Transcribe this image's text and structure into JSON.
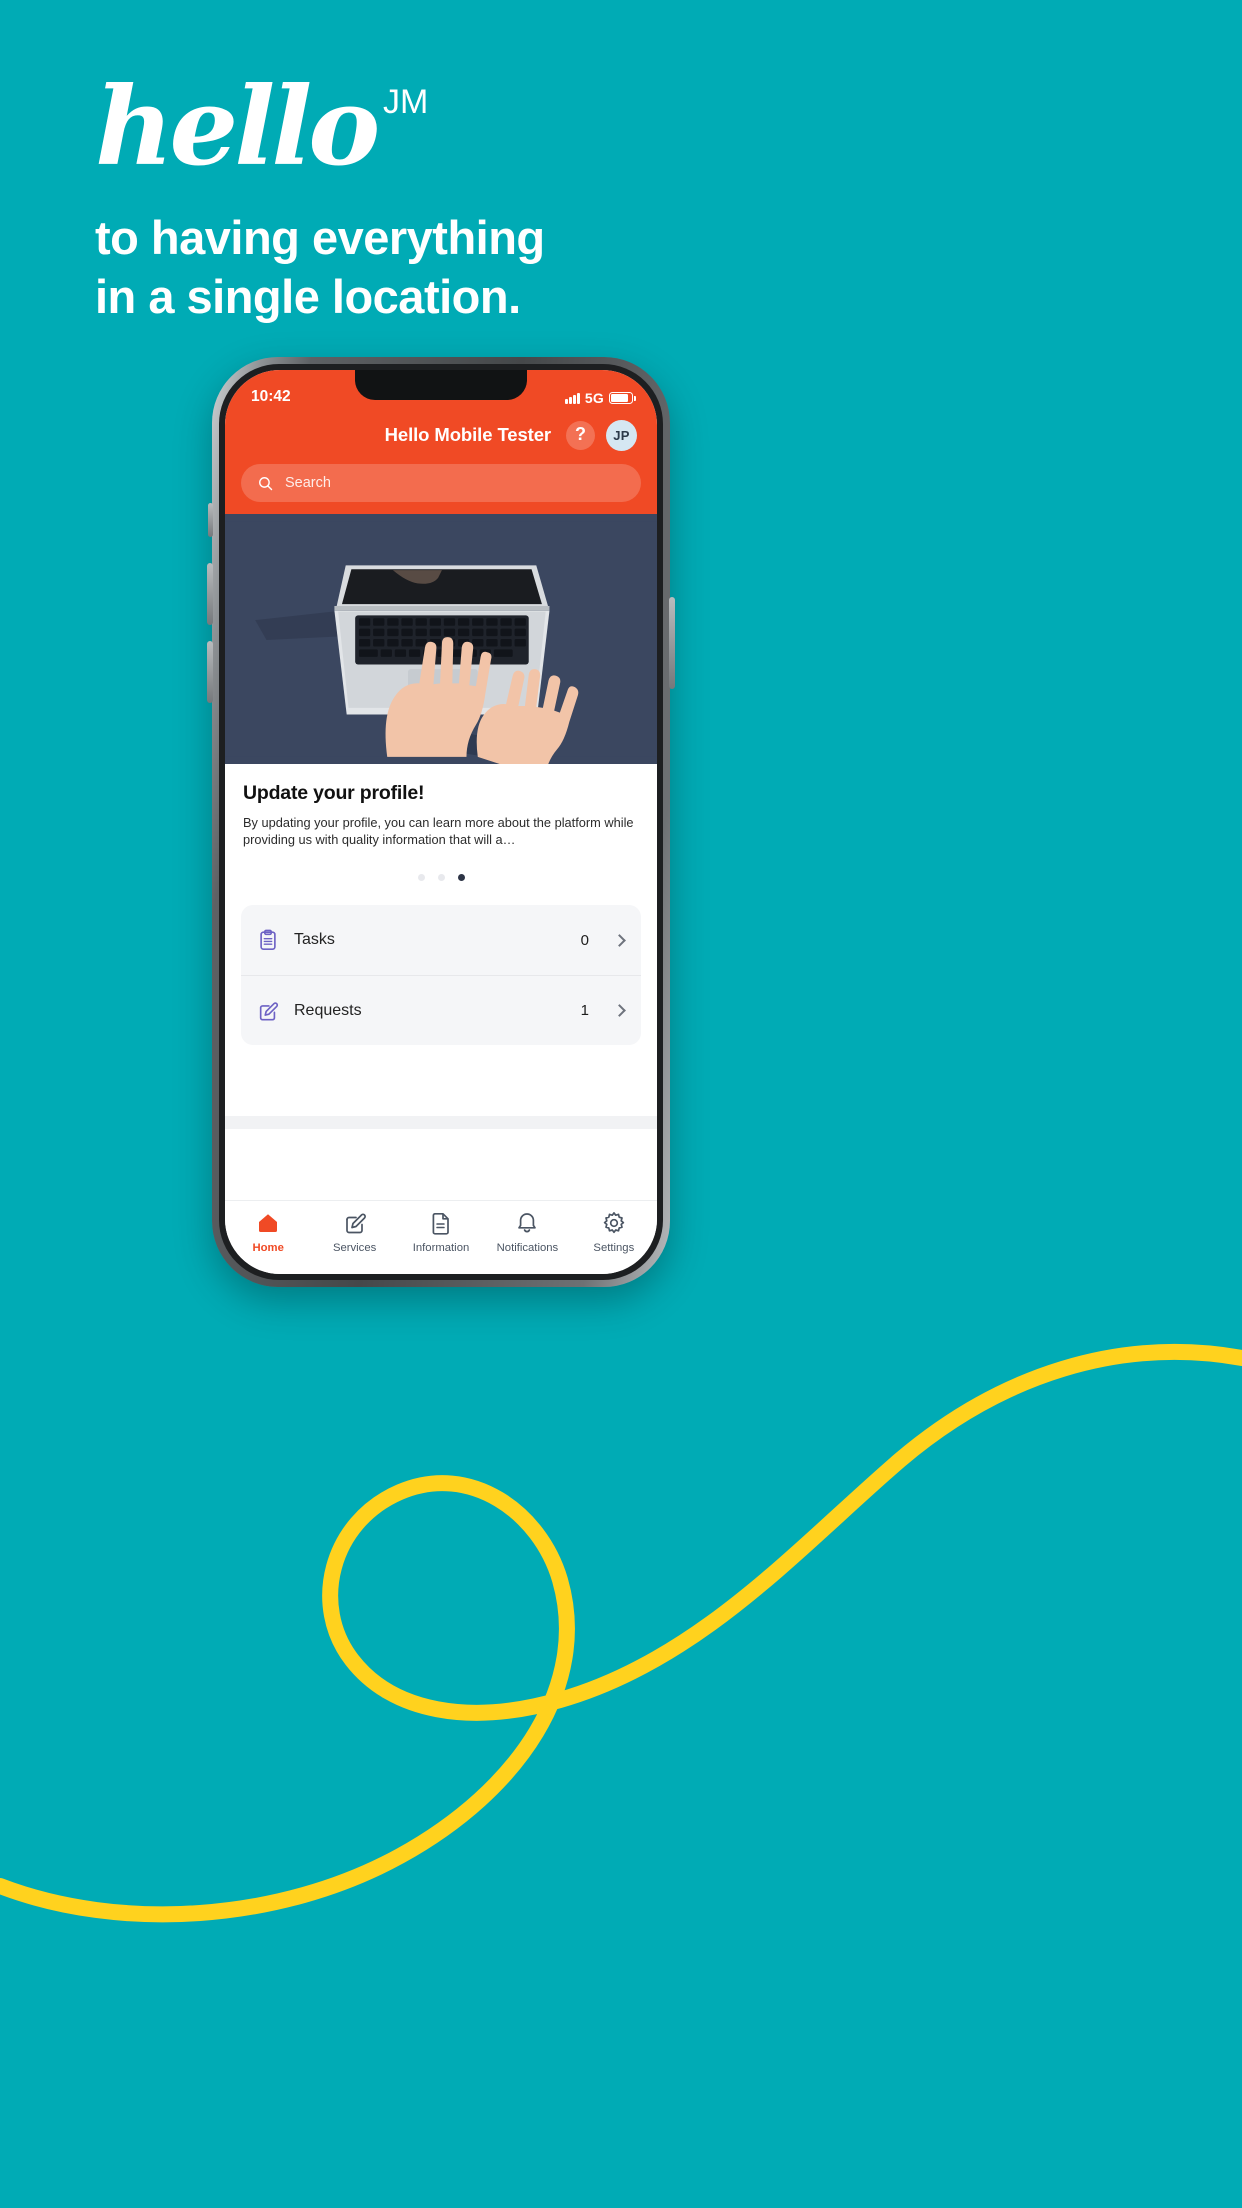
{
  "promo": {
    "logo_word": "hello",
    "logo_superscript": "JM",
    "tagline_line1": "to having everything",
    "tagline_line2": "in a single location."
  },
  "colors": {
    "background_teal": "#00abb5",
    "accent_red": "#f04a25",
    "swoosh_yellow": "#ffd21e",
    "hero_navy": "#3b4760",
    "icon_purple": "#6d62c4",
    "avatar_bg": "#d5e7f2"
  },
  "phone": {
    "statusbar": {
      "time": "10:42",
      "network": "5G",
      "signal_icon": "signal-bars-icon",
      "battery_icon": "battery-icon"
    },
    "header": {
      "title": "Hello Mobile  Tester",
      "help_icon": "question-mark-icon",
      "help_label": "?",
      "avatar_initials": "JP"
    },
    "search": {
      "placeholder": "Search",
      "value": "",
      "icon": "search-icon"
    },
    "hero": {
      "alt": "hands typing on laptop from above",
      "icon": "laptop-hands-image"
    },
    "card": {
      "title": "Update your profile!",
      "body": "By updating your profile, you can learn more about the platform while providing us with quality information that will a…",
      "carousel": {
        "total": 3,
        "active_index": 2
      }
    },
    "list": [
      {
        "label": "Tasks",
        "count": "0",
        "icon": "clipboard-icon"
      },
      {
        "label": "Requests",
        "count": "1",
        "icon": "edit-square-icon"
      }
    ],
    "tabs": [
      {
        "label": "Home",
        "icon": "home-icon",
        "active": true
      },
      {
        "label": "Services",
        "icon": "edit-square-icon",
        "active": false
      },
      {
        "label": "Information",
        "icon": "document-icon",
        "active": false
      },
      {
        "label": "Notifications",
        "icon": "bell-icon",
        "active": false
      },
      {
        "label": "Settings",
        "icon": "gear-icon",
        "active": false
      }
    ]
  }
}
